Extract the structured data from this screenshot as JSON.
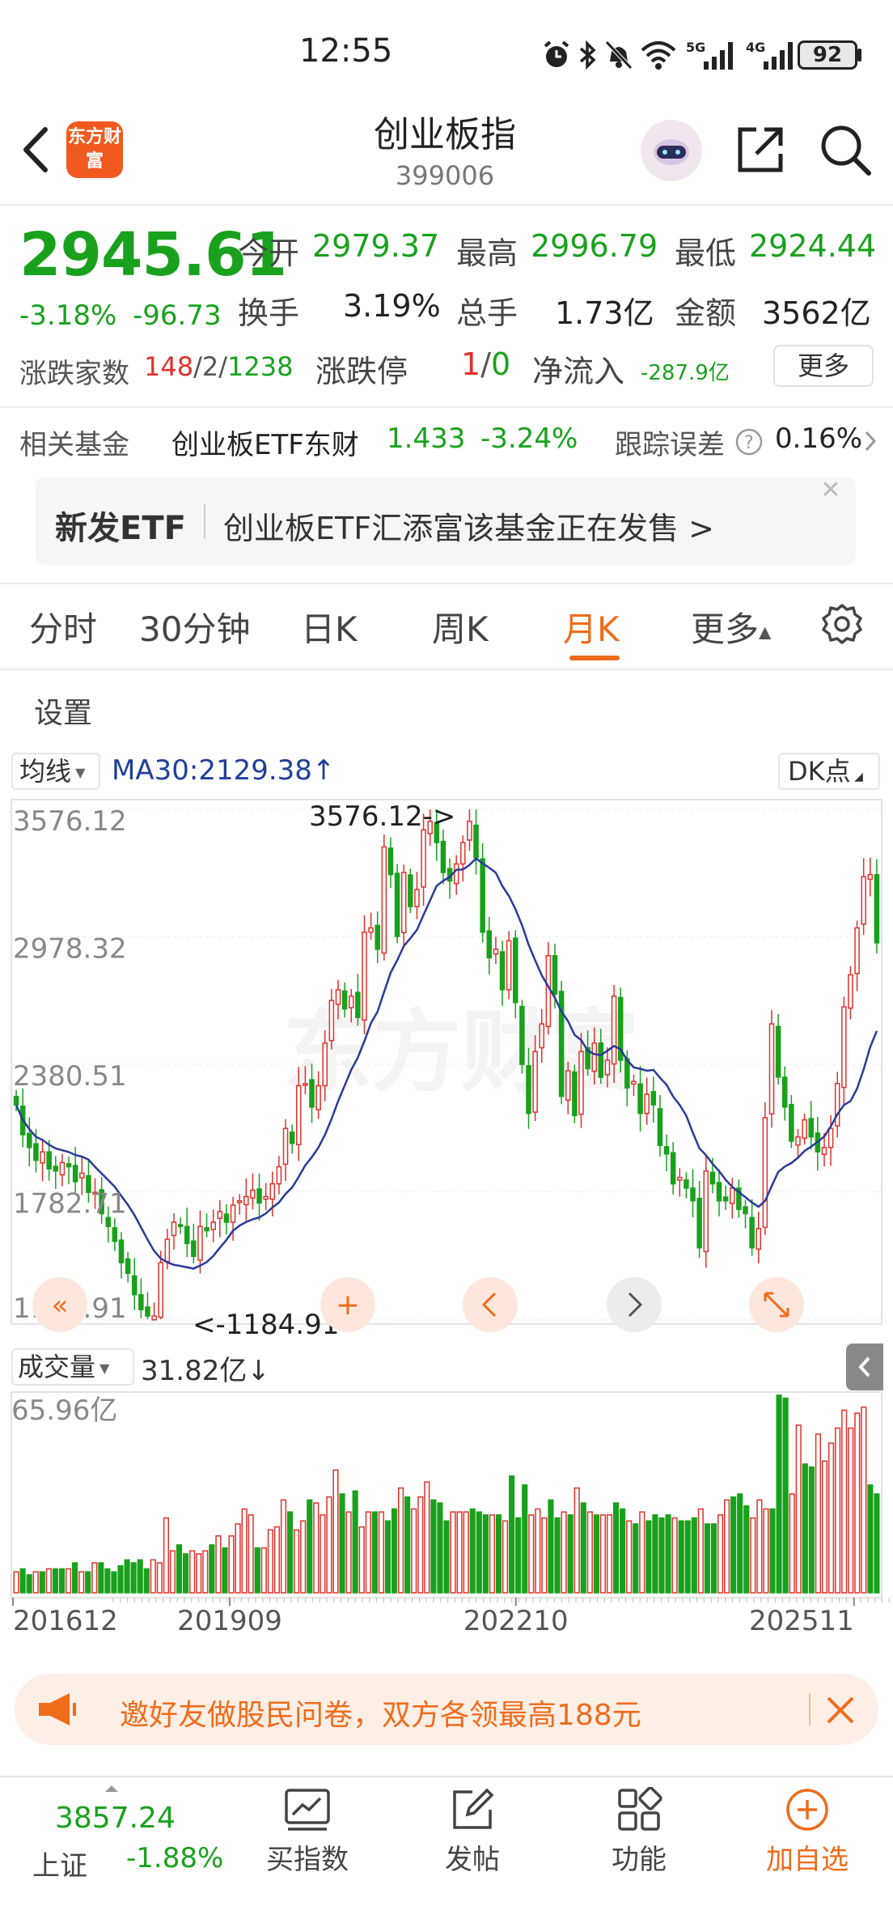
{
  "status_bar": {
    "time": "12:55",
    "battery": "92",
    "icons": [
      "alarm-icon",
      "bluetooth-icon",
      "mute-icon",
      "wifi-icon",
      "signal-5g-icon",
      "signal-4g-icon",
      "battery-icon"
    ]
  },
  "header": {
    "logo": "东方财富",
    "title": "创业板指",
    "code": "399006"
  },
  "quote": {
    "price": "2945.61",
    "pct": "-3.18%",
    "change": "-96.73",
    "open_label": "今开",
    "open": "2979.37",
    "high_label": "最高",
    "high": "2996.79",
    "low_label": "最低",
    "low": "2924.44",
    "turnover_label": "换手",
    "turnover": "3.19%",
    "volume_label": "总手",
    "volume": "1.73亿",
    "amount_label": "金额",
    "amount": "3562亿",
    "breadth_label": "涨跌家数",
    "up_count": "148",
    "flat_count": "2",
    "down_count": "1238",
    "limit_label": "涨跌停",
    "limit_up": "1",
    "limit_down": "0",
    "netflow_label": "净流入",
    "netflow": "-287.9亿",
    "more_label": "更多"
  },
  "fund": {
    "label": "相关基金",
    "name": "创业板ETF东财",
    "price": "1.433",
    "pct": "-3.24%",
    "tracking_label": "跟踪误差",
    "tracking": "0.16%"
  },
  "banner": {
    "tag": "新发ETF",
    "text": "创业板ETF汇添富该基金正在发售 >"
  },
  "tabs": [
    "分时",
    "30分钟",
    "日K",
    "周K",
    "月K",
    "更多"
  ],
  "active_tab": "月K",
  "settings_label": "设置",
  "chart_header": {
    "ma_select": "均线",
    "ma30": "MA30:2129.38↑",
    "dk_button": "DK点"
  },
  "volume_header": {
    "select": "成交量",
    "value": "31.82亿↓"
  },
  "chart_data": [
    {
      "type": "candlestick",
      "y_ticks": [
        "3576.12",
        "2978.32",
        "2380.51",
        "1782.71",
        "1184.91"
      ],
      "ylim": [
        1184.91,
        3576.12
      ],
      "annotations": [
        "3576.12->",
        "<-1184.91"
      ],
      "ma30_label": "MA30",
      "ma30_value": 2129.38,
      "x_ticks": [
        "201612",
        "201909",
        "202210",
        "202511"
      ],
      "up_color": "#e0312b",
      "down_color": "#19a11d",
      "ma_color": "#2a3a9a",
      "series_close": [
        2190,
        2050,
        1990,
        1930,
        1970,
        1890,
        1880,
        1920,
        1900,
        1830,
        1870,
        1780,
        1780,
        1680,
        1620,
        1550,
        1450,
        1400,
        1300,
        1230,
        1200,
        1200,
        1450,
        1560,
        1640,
        1620,
        1540,
        1480,
        1620,
        1600,
        1640,
        1690,
        1640,
        1720,
        1740,
        1760,
        1790,
        1730,
        1760,
        1820,
        1900,
        2080,
        2010,
        2280,
        2290,
        2180,
        2280,
        2480,
        2680,
        2730,
        2640,
        2700,
        2600,
        3000,
        3020,
        2920,
        3400,
        3270,
        2980,
        3280,
        3120,
        3200,
        3480,
        3520,
        3420,
        3280,
        3240,
        3320,
        3420,
        3520,
        3350,
        3000,
        2880,
        2920,
        2730,
        2960,
        2670,
        2380,
        2150,
        2440,
        2570,
        2890,
        2710,
        2230,
        2350,
        2140,
        2440,
        2360,
        2480,
        2320,
        2400,
        2700,
        2400,
        2270,
        2300,
        2150,
        2240,
        2190,
        2000,
        1960,
        1820,
        1850,
        1800,
        1740,
        1520,
        1880,
        1820,
        1740,
        1740,
        1800,
        1700,
        1680,
        1520,
        1610,
        2130,
        2570,
        2320,
        2180,
        2020,
        2040,
        2120,
        2040,
        1970,
        1990,
        2080,
        2290,
        2650,
        2800,
        3020,
        3260,
        3270,
        2950
      ]
    },
    {
      "type": "bar",
      "title": "成交量",
      "y_ticks": [
        "65.96亿"
      ],
      "ylim": [
        0,
        65.96
      ],
      "latest": "31.82亿",
      "values": [
        7,
        8,
        6,
        7,
        7,
        8,
        8,
        8,
        8,
        10,
        7,
        7,
        10,
        10,
        8,
        7,
        9,
        11,
        10,
        11,
        8,
        11,
        10,
        25,
        14,
        16,
        13,
        14,
        13,
        14,
        16,
        19,
        15,
        19,
        23,
        28,
        26,
        15,
        15,
        21,
        22,
        31,
        27,
        21,
        24,
        31,
        30,
        26,
        32,
        41,
        33,
        27,
        34,
        22,
        27,
        27,
        27,
        24,
        28,
        35,
        32,
        28,
        32,
        37,
        31,
        30,
        24,
        27,
        27,
        27,
        28,
        27,
        26,
        26,
        26,
        24,
        39,
        25,
        36,
        26,
        28,
        25,
        31,
        25,
        27,
        26,
        35,
        30,
        27,
        26,
        26,
        26,
        30,
        28,
        24,
        23,
        27,
        24,
        26,
        25,
        26,
        25,
        24,
        24,
        25,
        28,
        23,
        23,
        26,
        31,
        32,
        33,
        29,
        25,
        31,
        28,
        28,
        66,
        65,
        33,
        56,
        43,
        42,
        53,
        44,
        50,
        55,
        61,
        55,
        60,
        62,
        36,
        33
      ],
      "up_flags": [
        1,
        0,
        0,
        1,
        0,
        1,
        0,
        0,
        1,
        0,
        1,
        0,
        1,
        0,
        0,
        0,
        0,
        0,
        0,
        0,
        0,
        1,
        1,
        1,
        1,
        0,
        0,
        1,
        1,
        1,
        0,
        1,
        0,
        1,
        1,
        1,
        1,
        0,
        1,
        1,
        1,
        1,
        0,
        1,
        1,
        0,
        1,
        1,
        1,
        1,
        0,
        1,
        0,
        1,
        1,
        0,
        1,
        0,
        0,
        1,
        0,
        1,
        1,
        1,
        0,
        0,
        0,
        1,
        1,
        1,
        0,
        0,
        0,
        1,
        0,
        1,
        0,
        0,
        0,
        1,
        1,
        1,
        0,
        0,
        1,
        0,
        1,
        0,
        1,
        0,
        1,
        1,
        0,
        0,
        1,
        0,
        1,
        0,
        0,
        0,
        0,
        1,
        0,
        0,
        0,
        1,
        0,
        0,
        1,
        1,
        0,
        0,
        0,
        1,
        1,
        1,
        0,
        0,
        0,
        1,
        1,
        0,
        0,
        1,
        1,
        1,
        1,
        1,
        1,
        1,
        1,
        0,
        0
      ]
    }
  ],
  "promo": {
    "text": "邀好友做股民问卷，双方各领最高188元"
  },
  "bottom_nav": {
    "index_value": "3857.24",
    "index_name": "上证",
    "index_pct": "-1.88%",
    "items": [
      "买指数",
      "发帖",
      "功能",
      "加自选"
    ]
  },
  "watermark": "东方财富"
}
